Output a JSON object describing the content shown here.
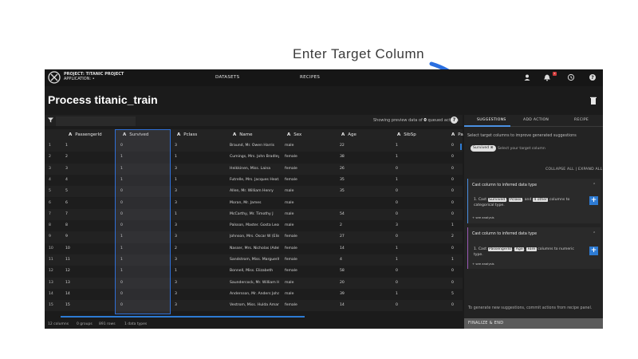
{
  "annotation": {
    "text": "Enter Target Column",
    "arrow_color": "#2a6fe0"
  },
  "topnav": {
    "project_line": "PROJECT: TITANIC PROJECT",
    "app_line": "APPLICATION: •",
    "items": [
      "DATASETS",
      "RECIPES"
    ],
    "bell_count": "1"
  },
  "page": {
    "title": "Process titanic_train"
  },
  "filterbar": {
    "preview_prefix": "Showing preview data of",
    "preview_count": "0",
    "preview_suffix": "queued actions"
  },
  "table": {
    "columns": [
      {
        "type": "A",
        "name": "PassengerId"
      },
      {
        "type": "A",
        "name": "Survived"
      },
      {
        "type": "A",
        "name": "Pclass"
      },
      {
        "type": "A",
        "name": "Name"
      },
      {
        "type": "A",
        "name": "Sex"
      },
      {
        "type": "A",
        "name": "Age"
      },
      {
        "type": "A",
        "name": "SibSp"
      },
      {
        "type": "A",
        "name": "Pa"
      }
    ],
    "rows": [
      [
        "1",
        "1",
        "0",
        "3",
        "Braund, Mr. Owen Harris",
        "male",
        "22",
        "1",
        "0"
      ],
      [
        "2",
        "2",
        "1",
        "1",
        "Cumings, Mrs. John Bradley ...",
        "female",
        "38",
        "1",
        "0"
      ],
      [
        "3",
        "3",
        "1",
        "3",
        "Heikkinen, Miss. Laina",
        "female",
        "26",
        "0",
        "0"
      ],
      [
        "4",
        "4",
        "1",
        "1",
        "Futrelle, Mrs. Jacques Heat...",
        "female",
        "35",
        "1",
        "0"
      ],
      [
        "5",
        "5",
        "0",
        "3",
        "Allen, Mr. William Henry",
        "male",
        "35",
        "0",
        "0"
      ],
      [
        "6",
        "6",
        "0",
        "3",
        "Moran, Mr. James",
        "male",
        "",
        "0",
        "0"
      ],
      [
        "7",
        "7",
        "0",
        "1",
        "McCarthy, Mr. Timothy J",
        "male",
        "54",
        "0",
        "0"
      ],
      [
        "8",
        "8",
        "0",
        "3",
        "Palsson, Master. Gosta Leon...",
        "male",
        "2",
        "3",
        "1"
      ],
      [
        "9",
        "9",
        "1",
        "3",
        "Johnson, Mrs. Oscar W (Elis...",
        "female",
        "27",
        "0",
        "2"
      ],
      [
        "10",
        "10",
        "1",
        "2",
        "Nasser, Mrs. Nicholas (Adel...",
        "female",
        "14",
        "1",
        "0"
      ],
      [
        "11",
        "11",
        "1",
        "3",
        "Sandstrom, Miss. Marguerit...",
        "female",
        "4",
        "1",
        "1"
      ],
      [
        "12",
        "12",
        "1",
        "1",
        "Bonnell, Miss. Elizabeth",
        "female",
        "58",
        "0",
        "0"
      ],
      [
        "13",
        "13",
        "0",
        "3",
        "Saundercock, Mr. William He...",
        "male",
        "20",
        "0",
        "0"
      ],
      [
        "14",
        "14",
        "0",
        "3",
        "Andersson, Mr. Anders Johan",
        "male",
        "39",
        "1",
        "5"
      ],
      [
        "15",
        "15",
        "0",
        "3",
        "Vestrom, Miss. Hulda Aman...",
        "female",
        "14",
        "0",
        "0"
      ]
    ]
  },
  "footer": {
    "columns": "12 columns",
    "groups": "0 groups",
    "rows": "891 rows",
    "types": "1 data types"
  },
  "panel": {
    "tabs": [
      "SUGGESTIONS",
      "ADD ACTION",
      "RECIPE"
    ],
    "hint": "Select target columns to improve generated suggestions",
    "chip": "Survived",
    "chip_hint": "Select your target column",
    "collapse_all": "COLLAPSE ALL",
    "expand_all": "EXPAND ALL",
    "card1": {
      "title": "Cast column to inferred data type",
      "prefix": "1. Cast",
      "tags": [
        "Survived",
        "Pclass"
      ],
      "and": "and",
      "tag_other": "4 other",
      "suffix": "columns to categorical type.",
      "see": "+ see analysis"
    },
    "card2": {
      "title": "Cast column to inferred data type",
      "prefix": "1. Cast",
      "tags": [
        "PassengerId",
        "Age",
        "Fare"
      ],
      "suffix": "columns to numeric type.",
      "see": "+ see analysis"
    },
    "gen_hint": "To generate new suggestions, commit actions from recipe panel.",
    "finalize": "FINALIZE & END"
  }
}
